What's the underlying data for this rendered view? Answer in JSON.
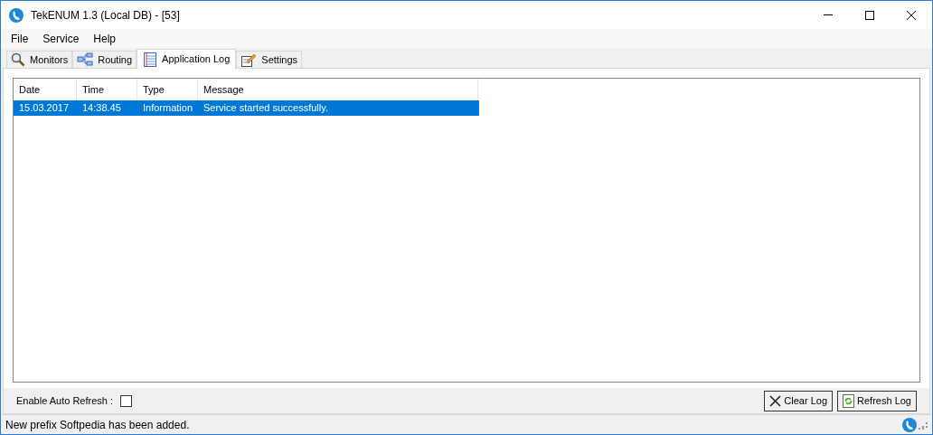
{
  "window": {
    "title": "TekENUM 1.3 (Local DB) - [53]"
  },
  "menu": [
    "File",
    "Service",
    "Help"
  ],
  "tabs": [
    {
      "label": "Monitors",
      "selected": false,
      "kind": "search"
    },
    {
      "label": "Routing",
      "selected": false,
      "kind": "routing"
    },
    {
      "label": "Application Log",
      "selected": true,
      "kind": "log"
    },
    {
      "label": "Settings",
      "selected": false,
      "kind": "settings"
    }
  ],
  "table": {
    "columns": [
      "Date",
      "Time",
      "Type",
      "Message"
    ],
    "rows": [
      {
        "cells": [
          "15.03.2017",
          "14:38.45",
          "Information",
          "Service started successfully."
        ],
        "selected": true
      }
    ]
  },
  "auto_refresh": {
    "label": "Enable Auto Refresh :",
    "checked": false
  },
  "buttons": [
    {
      "label": "Clear Log",
      "kind": "clear"
    },
    {
      "label": "Refresh Log",
      "kind": "refresh"
    }
  ],
  "status_bar": "New prefix Softpedia has been added."
}
